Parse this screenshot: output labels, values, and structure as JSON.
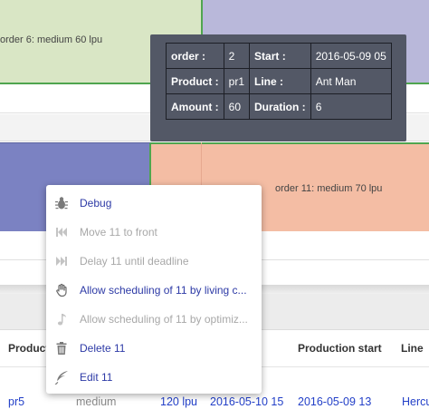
{
  "gantt": {
    "order6_label": "order 6: medium 60 lpu",
    "order11_label": "order 11: medium 70 lpu"
  },
  "tooltip": {
    "rows": [
      [
        {
          "label": "order :",
          "value": "2"
        },
        {
          "label": "Start :",
          "value": "2016-05-09 05"
        }
      ],
      [
        {
          "label": "Product :",
          "value": "pr1"
        },
        {
          "label": "Line :",
          "value": "Ant Man"
        }
      ],
      [
        {
          "label": "Amount :",
          "value": "60"
        },
        {
          "label": "Duration :",
          "value": "6"
        }
      ]
    ]
  },
  "context_menu": {
    "items": [
      {
        "label": "Debug",
        "icon": "bug-icon",
        "enabled": true
      },
      {
        "label": "Move 11 to front",
        "icon": "skip-back-icon",
        "enabled": false
      },
      {
        "label": "Delay 11 until deadline",
        "icon": "skip-forward-icon",
        "enabled": false
      },
      {
        "label": "Allow scheduling of 11 by living c...",
        "icon": "hand-icon",
        "enabled": true
      },
      {
        "label": "Allow scheduling of 11 by optimiz...",
        "icon": "music-note-icon",
        "enabled": false
      },
      {
        "label": "Delete 11",
        "icon": "trash-icon",
        "enabled": true
      },
      {
        "label": "Edit 11",
        "icon": "feather-icon",
        "enabled": true
      }
    ]
  },
  "table": {
    "headers": {
      "product": "Product",
      "production_start": "Production start",
      "line": "Line"
    },
    "row": {
      "product": "pr5",
      "priority": "medium",
      "rate": "120 lpu",
      "deadline": "2016-05-10 15",
      "production_start": "2016-05-09 13",
      "line": "Hercu"
    }
  },
  "colors": {
    "tooltip_bg": "#535866",
    "menu_enabled_text": "#2d3aa6",
    "menu_disabled_text": "#a8a8a8",
    "link": "#2340c8",
    "order6_fill": "#d9e6c5",
    "order11_fill": "#f4bda4",
    "blue_block": "#7b82c2",
    "purple_block": "#b9b8da",
    "border_green": "#4fa54f"
  }
}
